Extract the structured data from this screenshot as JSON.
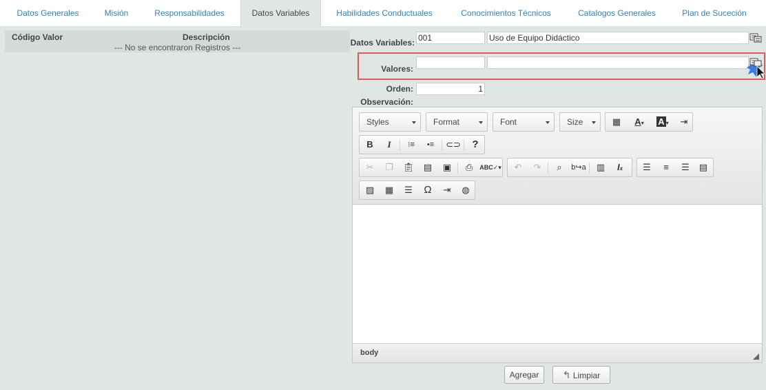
{
  "tabs": [
    {
      "label": "Datos Generales"
    },
    {
      "label": "Misión"
    },
    {
      "label": "Responsabilidades"
    },
    {
      "label": "Datos Variables"
    },
    {
      "label": "Habilidades Conductuales"
    },
    {
      "label": "Conocimientos Técnicos"
    },
    {
      "label": "Catalogos Generales"
    },
    {
      "label": "Plan de Suceción"
    }
  ],
  "active_tab": "Datos Variables",
  "table": {
    "columns": [
      "Código Valor",
      "Descripción"
    ],
    "empty_message": "--- No se encontraron Registros ---"
  },
  "form": {
    "datos_variables": {
      "label": "Datos Variables:",
      "code": "001",
      "description": "Uso de Equipo Didáctico"
    },
    "valores": {
      "label": "Valores:",
      "code": "",
      "description": ""
    },
    "orden": {
      "label": "Orden:",
      "value": "1"
    },
    "observacion": {
      "label": "Observación:"
    }
  },
  "editor": {
    "combos": {
      "styles": "Styles",
      "format": "Format",
      "font": "Font",
      "size": "Size"
    },
    "status_path": "body"
  },
  "buttons": {
    "add": "Agregar",
    "clear": "Limpiar"
  },
  "colors": {
    "tab_link": "#2f82c1",
    "highlight_border": "#e05a5a",
    "background": "#dfe6e3"
  }
}
